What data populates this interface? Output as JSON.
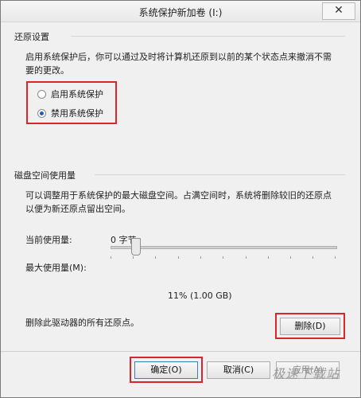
{
  "window": {
    "title": "系统保护新加卷 (I:)",
    "close_glyph": "✕"
  },
  "restore_settings": {
    "group_label": "还原设置",
    "description_line1": "启用系统保护后，你可以通过及时将计算机还原到以前的某个状态点来撤消不需",
    "description_line2": "要的更改。",
    "options": [
      {
        "label": "启用系统保护",
        "checked": false
      },
      {
        "label": "禁用系统保护",
        "checked": true
      }
    ]
  },
  "disk_usage": {
    "group_label": "磁盘空间使用量",
    "description_line1": "可以调整用于系统保护的最大磁盘空间。占满空间时，系统将删除较旧的还原点",
    "description_line2": "以便为新还原点留出空间。",
    "current_usage_label": "当前使用量:",
    "current_usage_value": "0 字节",
    "max_usage_label": "最大使用量(M):",
    "slider_value_text": "11% (1.00 GB)",
    "slider_fraction": 0.11
  },
  "delete_section": {
    "description": "删除此驱动器的所有还原点。",
    "delete_button": "删除(D)"
  },
  "footer": {
    "ok_button": "确定(O)",
    "cancel_button": "取消(C)",
    "apply_button": "应用(A)"
  },
  "watermark": "极速下载站",
  "colors": {
    "highlight_box": "#d8262b",
    "radio_dot": "#1d5fbf"
  }
}
